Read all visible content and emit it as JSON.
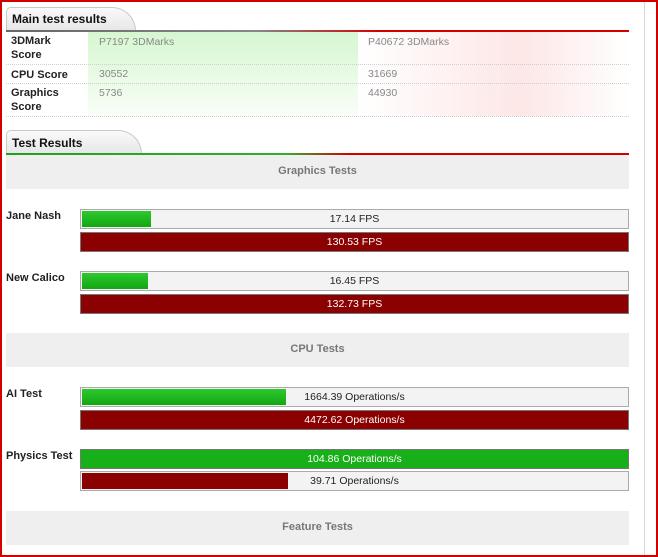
{
  "main_results": {
    "title": "Main test results",
    "rows": [
      {
        "label": "3DMark Score",
        "left": "P7197 3DMarks",
        "right": "P40672 3DMarks"
      },
      {
        "label": "CPU Score",
        "left": "30552",
        "right": "31669"
      },
      {
        "label": "Graphics Score",
        "left": "5736",
        "right": "44930"
      }
    ]
  },
  "test_results": {
    "title": "Test Results",
    "categories": {
      "graphics": "Graphics Tests",
      "cpu": "CPU Tests",
      "feature": "Feature Tests"
    },
    "tests": [
      {
        "name": "Jane Nash",
        "a_value": "17.14 FPS",
        "a_fraction": 0.13,
        "b_value": "130.53 FPS",
        "b_fraction": 1.0
      },
      {
        "name": "New Calico",
        "a_value": "16.45 FPS",
        "a_fraction": 0.125,
        "b_value": "132.73 FPS",
        "b_fraction": 1.0
      },
      {
        "name": "AI Test",
        "a_value": "1664.39 Operations/s",
        "a_fraction": 0.377,
        "b_value": "4472.62 Operations/s",
        "b_fraction": 1.0
      },
      {
        "name": "Physics Test",
        "a_value": "104.86 Operations/s",
        "a_fraction": 1.0,
        "b_value": "39.71 Operations/s",
        "b_fraction": 0.38
      }
    ]
  },
  "colors": {
    "accent_red": "#d40000",
    "bar_red": "#8b0000",
    "bar_green": "#18b018"
  }
}
